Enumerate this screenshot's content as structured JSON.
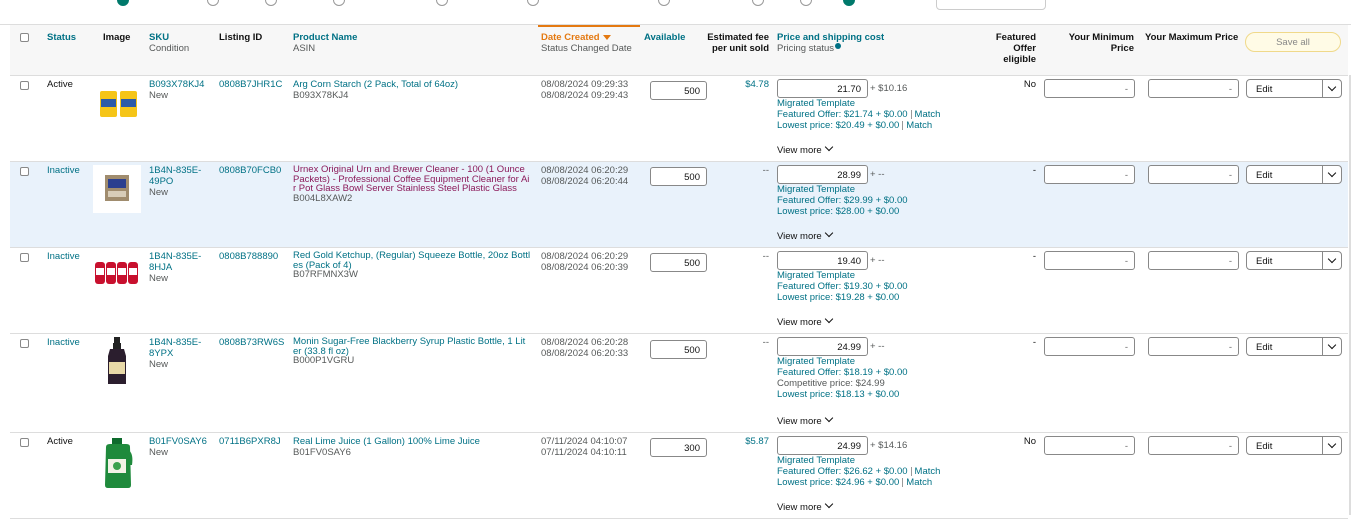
{
  "header": {
    "status": "Status",
    "image": "Image",
    "sku": "SKU",
    "condition": "Condition",
    "listing_id": "Listing ID",
    "product_name": "Product Name",
    "asin": "ASIN",
    "date_created": "Date Created",
    "status_changed": "Status Changed Date",
    "available": "Available",
    "fee_l1": "Estimated fee",
    "fee_l2": "per unit sold",
    "price": "Price and shipping cost",
    "pricing_status": "Pricing status",
    "featured_l1": "Featured",
    "featured_l2": "Offer",
    "featured_l3": "eligible",
    "min_l1": "Your Minimum",
    "min_l2": "Price",
    "max": "Your Maximum Price",
    "save_all": "Save all"
  },
  "colors": {
    "link": "#007185",
    "accent_sort": "#e47911",
    "highlight_row": "#e9f2fb",
    "product_visited": "#8b1a5a"
  },
  "rows": [
    {
      "status": "Active",
      "sku": "B093X78KJ4",
      "condition": "New",
      "listing_id": "0808B7JHR1C",
      "name_l1": "Arg Corn Starch (2 Pack, Total of 64oz)",
      "name_l2": "",
      "asin": "B093X78KJ4",
      "date1": "08/08/2024 09:29:33",
      "date2": "08/08/2024 09:29:43",
      "available": "500",
      "fee": "$4.78",
      "price": "21.70",
      "plus": "+ $10.16",
      "template": "Migrated Template",
      "featured_offer": "Featured Offer: $21.74 + $0.00",
      "featured_match": "Match",
      "competitive": "",
      "lowest": "Lowest price: $20.49 + $0.00",
      "lowest_match": "Match",
      "view_more": "View more",
      "featured_eligible": "No",
      "min": "-",
      "max": "-",
      "edit": "Edit",
      "thumb": "corn-starch-image"
    },
    {
      "status": "Inactive",
      "sku": "1B4N-835E-",
      "sku2": "49PO",
      "condition": "New",
      "listing_id": "0808B70FCB0",
      "name_l1": "Urnex Original Urn and Brewer Cleaner - 100 (1 Ounce",
      "name_l2": "Packets) - Professional Coffee Equipment Cleaner for Ai",
      "name_l3": "r Pot Glass Bowl Server Stainless Steel Plastic Glass",
      "asin": "B004L8XAW2",
      "date1": "08/08/2024 06:20:29",
      "date2": "08/08/2024 06:20:44",
      "available": "500",
      "fee": "--",
      "price": "28.99",
      "plus": "+ --",
      "template": "Migrated Template",
      "featured_offer": "Featured Offer: $29.99 + $0.00",
      "competitive": "",
      "lowest": "Lowest price: $28.00 + $0.00",
      "view_more": "View more",
      "featured_eligible": "-",
      "min": "-",
      "max": "-",
      "edit": "Edit",
      "thumb": "urnex-cleaner-image"
    },
    {
      "status": "Inactive",
      "sku": "1B4N-835E-",
      "sku2": "8HJA",
      "condition": "New",
      "listing_id": "0808B788890",
      "name_l1": "Red Gold Ketchup, (Regular) Squeeze Bottle, 20oz Bottl",
      "name_l2": "es (Pack of 4)",
      "asin": "B07RFMNX3W",
      "date1": "08/08/2024 06:20:29",
      "date2": "08/08/2024 06:20:39",
      "available": "500",
      "fee": "--",
      "price": "19.40",
      "plus": "+ --",
      "template": "Migrated Template",
      "featured_offer": "Featured Offer: $19.30 + $0.00",
      "competitive": "",
      "lowest": "Lowest price: $19.28 + $0.00",
      "view_more": "View more",
      "featured_eligible": "-",
      "min": "-",
      "max": "-",
      "edit": "Edit",
      "thumb": "ketchup-image"
    },
    {
      "status": "Inactive",
      "sku": "1B4N-835E-",
      "sku2": "8YPX",
      "condition": "New",
      "listing_id": "0808B73RW6S",
      "name_l1": "Monin Sugar-Free Blackberry Syrup Plastic Bottle, 1 Lit",
      "name_l2": "er (33.8 fl oz)",
      "asin": "B000P1VGRU",
      "date1": "08/08/2024 06:20:28",
      "date2": "08/08/2024 06:20:33",
      "available": "500",
      "fee": "--",
      "price": "24.99",
      "plus": "+ --",
      "template": "Migrated Template",
      "featured_offer": "Featured Offer: $18.19 + $0.00",
      "competitive": "Competitive price: $24.99",
      "lowest": "Lowest price: $18.13 + $0.00",
      "view_more": "View more",
      "featured_eligible": "-",
      "min": "-",
      "max": "-",
      "edit": "Edit",
      "thumb": "syrup-bottle-image"
    },
    {
      "status": "Active",
      "sku": "B01FV0SAY6",
      "condition": "New",
      "listing_id": "0711B6PXR8J",
      "name_l1": "Real Lime Juice (1 Gallon) 100% Lime Juice",
      "name_l2": "",
      "asin": "B01FV0SAY6",
      "date1": "07/11/2024 04:10:07",
      "date2": "07/11/2024 04:10:11",
      "available": "300",
      "fee": "$5.87",
      "price": "24.99",
      "plus": "+ $14.16",
      "template": "Migrated Template",
      "featured_offer": "Featured Offer: $26.62 + $0.00",
      "featured_match": "Match",
      "competitive": "",
      "lowest": "Lowest price: $24.96 + $0.00",
      "lowest_match": "Match",
      "view_more": "View more",
      "featured_eligible": "No",
      "min": "-",
      "max": "-",
      "edit": "Edit",
      "thumb": "lime-juice-image"
    }
  ]
}
